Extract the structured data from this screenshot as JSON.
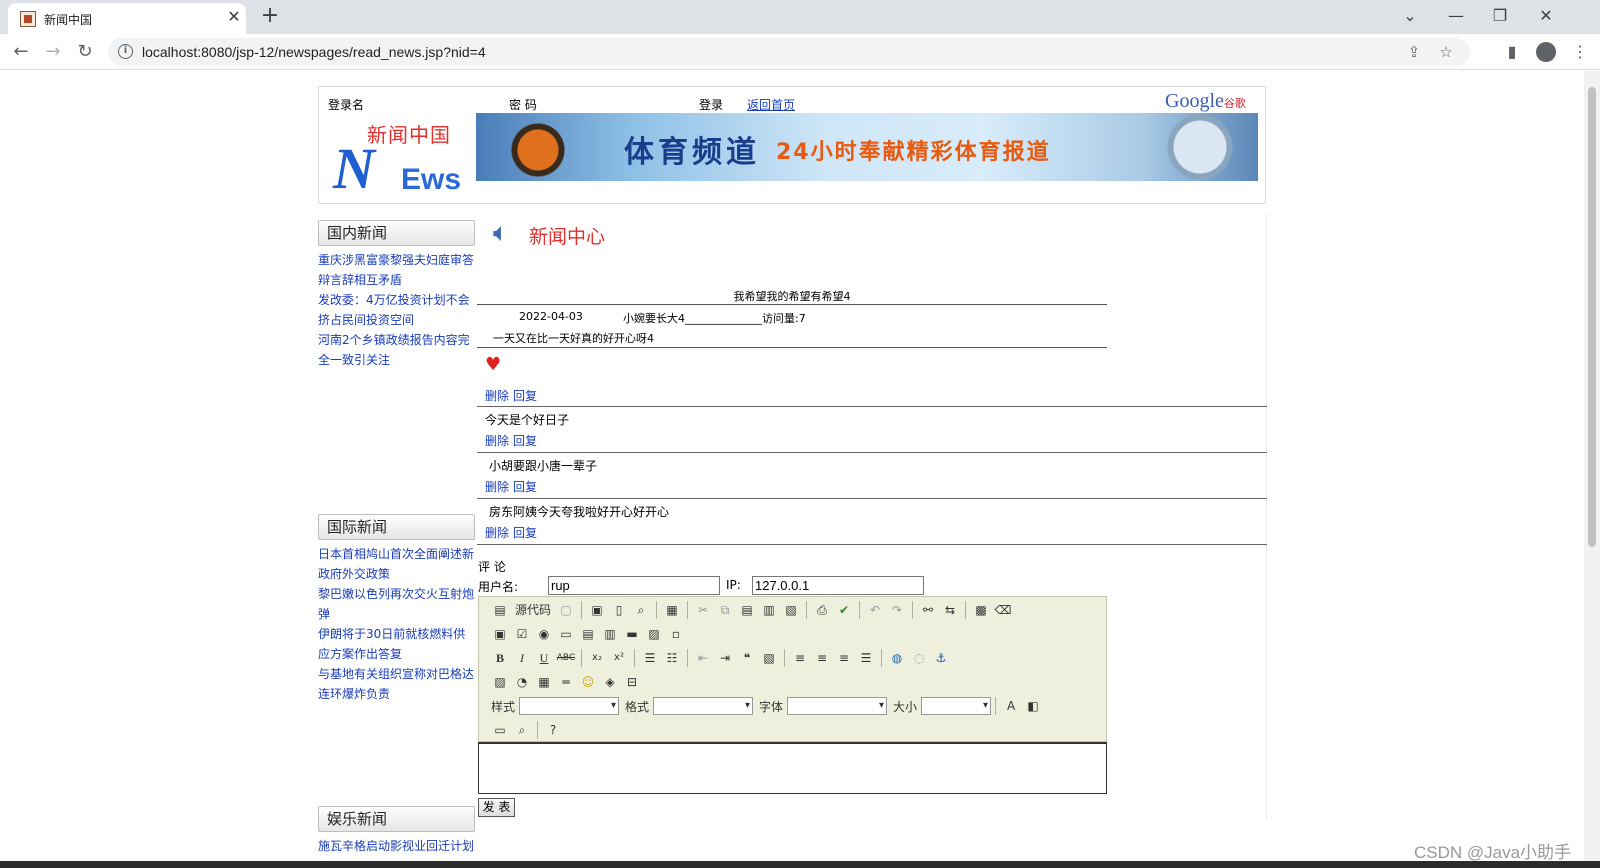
{
  "browser": {
    "tab_title": "新闻中国",
    "tab_close": "✕",
    "new_tab": "+",
    "url": "localhost:8080/jsp-12/newspages/read_news.jsp?nid=4",
    "win_min": "—",
    "win_restore": "❐",
    "win_close": "✕",
    "tab_list": "⌄"
  },
  "header": {
    "login_name_label": "登录名",
    "password_label": "密 码",
    "login_label": "登录",
    "home_link": "返回首页",
    "google_text": "Google",
    "google_cn": "谷歌",
    "logo_cn": "新闻中国",
    "logo_n": "N",
    "logo_ews": "Ews",
    "banner_title": "体育频道",
    "banner_sub": "24小时奉献精彩体育报道"
  },
  "sidebar": {
    "domestic": {
      "title": "国内新闻",
      "items": [
        "重庆涉黑富豪黎强夫妇庭审答",
        "辩言辞相互矛盾",
        "发改委：4万亿投资计划不会",
        "挤占民间投资空间",
        "河南2个乡镇政绩报告内容完",
        "全一致引关注"
      ]
    },
    "international": {
      "title": "国际新闻",
      "items": [
        "日本首相鸠山首次全面阐述新",
        "政府外交政策",
        "黎巴嫩以色列再次交火互射炮",
        "弹",
        "伊朗将于30日前就核燃料供",
        "应方案作出答复",
        "与基地有关组织宣称对巴格达",
        "连环爆炸负责"
      ]
    },
    "entertainment": {
      "title": "娱乐新闻",
      "items": [
        "施瓦辛格启动影视业回迁计划"
      ]
    }
  },
  "main": {
    "center_title": "新闻中心",
    "news_title": "我希望我的希望有希望4",
    "date": "2022-04-03",
    "author": "小婉要长大4______________访问量:7",
    "content": "一天又在比一天好真的好开心呀4",
    "delete_label": "删除",
    "reply_label": "回复",
    "comments": [
      "今天是个好日子",
      "小胡要跟小唐一辈子",
      "房东阿姨今天夸我啦好开心好开心"
    ],
    "comment_label": "评 论",
    "username_label": "用户名:",
    "username_value": "rup",
    "ip_label": "IP:",
    "ip_value": "127.0.0.1",
    "submit_label": "发 表"
  },
  "editor": {
    "source_label": "源代码",
    "style_label": "样式",
    "format_label": "格式",
    "font_label": "字体",
    "size_label": "大小"
  },
  "watermark": "CSDN @Java小助手"
}
